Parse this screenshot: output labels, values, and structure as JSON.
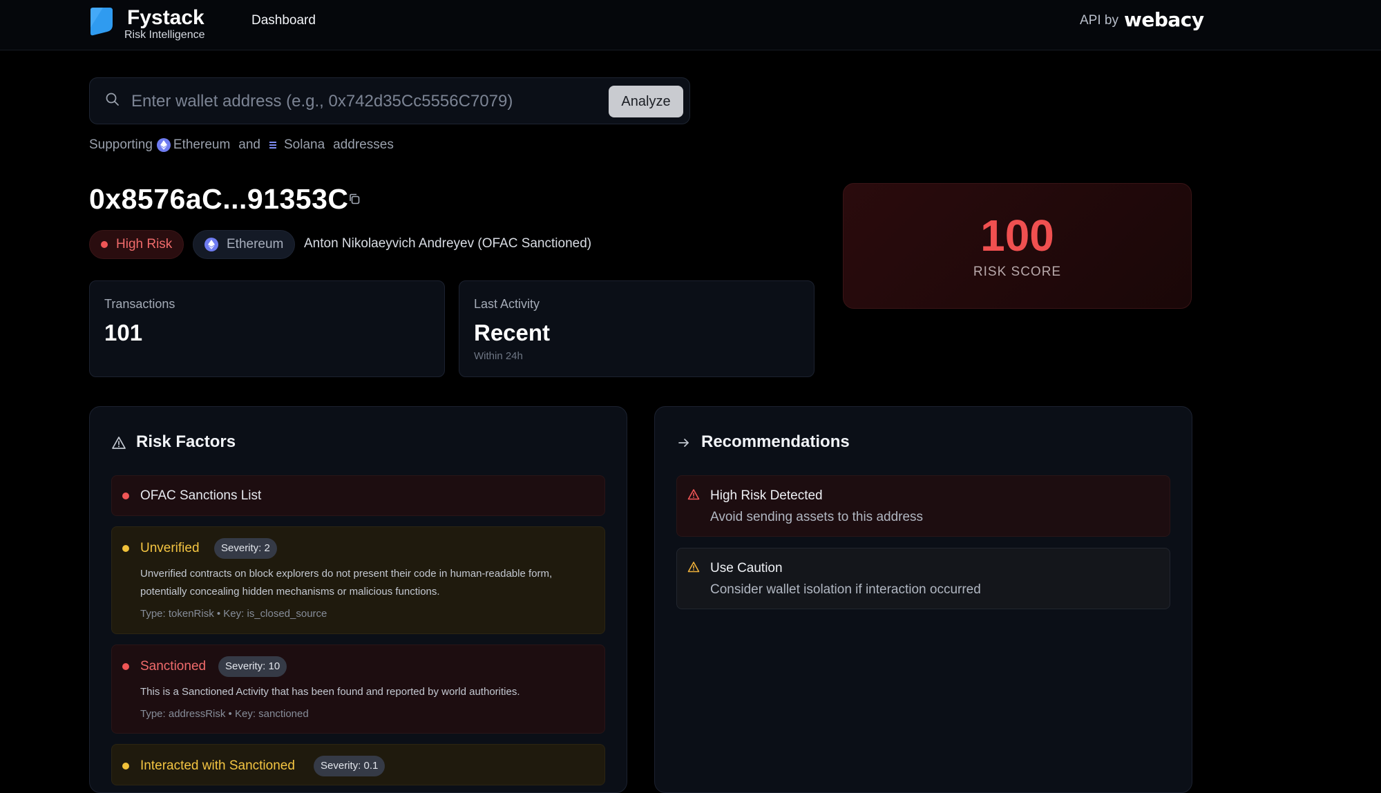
{
  "header": {
    "brand_name": "Fystack",
    "brand_sub": "Risk Intelligence",
    "nav_dashboard": "Dashboard",
    "api_by": "API by",
    "api_partner": "webacy"
  },
  "search": {
    "placeholder": "Enter wallet address (e.g., 0x742d35Cc5556C7079)",
    "value": "",
    "button_label": "Analyze"
  },
  "support": {
    "prefix": "Supporting",
    "chain1": "Ethereum",
    "conj": "and",
    "chain2": "Solana",
    "suffix": "addresses"
  },
  "wallet": {
    "address": "0x8576aC...91353C",
    "risk_badge": "High Risk",
    "chain_badge": "Ethereum",
    "entity": "Anton Nikolaeyvich Andreyev (OFAC Sanctioned)"
  },
  "stats": {
    "transactions_label": "Transactions",
    "transactions_value": "101",
    "activity_label": "Last Activity",
    "activity_value": "Recent",
    "activity_sub": "Within 24h"
  },
  "score": {
    "value": "100",
    "label": "RISK SCORE"
  },
  "risk_factors": {
    "title": "Risk Factors",
    "items": [
      {
        "title": "OFAC Sanctions List"
      },
      {
        "title": "Unverified",
        "severity": "Severity: 2",
        "desc": "Unverified contracts on block explorers do not present their code in human-readable form, potentially concealing hidden mechanisms or malicious functions.",
        "meta": "Type: tokenRisk • Key: is_closed_source"
      },
      {
        "title": "Sanctioned",
        "severity": "Severity: 10",
        "desc": "This is a Sanctioned Activity that has been found and reported by world authorities.",
        "meta": "Type: addressRisk • Key: sanctioned"
      },
      {
        "title": "Interacted with Sanctioned",
        "severity": "Severity: 0.1"
      }
    ]
  },
  "recommendations": {
    "title": "Recommendations",
    "items": [
      {
        "title": "High Risk Detected",
        "desc": "Avoid sending assets to this address"
      },
      {
        "title": "Use Caution",
        "desc": "Consider wallet isolation if interaction occurred"
      }
    ]
  },
  "colors": {
    "accent_red": "#f05050",
    "accent_yellow": "#f4c542",
    "eth": "#6f7cf0",
    "logo": "#2f9bf0"
  }
}
